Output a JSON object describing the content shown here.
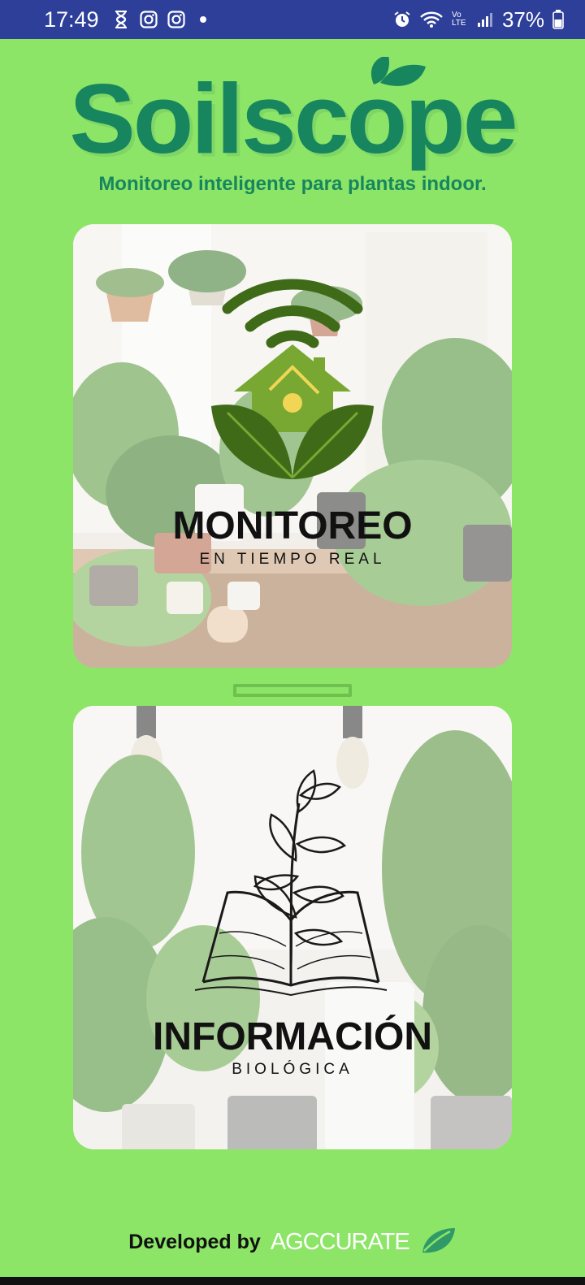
{
  "status_bar": {
    "time": "17:49",
    "battery": "37%",
    "network": "Vo LTE",
    "left_icons": [
      "hourglass-icon",
      "instagram-icon",
      "instagram-icon",
      "notification-dot"
    ],
    "right_icons": [
      "alarm-icon",
      "wifi-icon",
      "signal-icon",
      "battery-icon"
    ]
  },
  "header": {
    "app_name": "Soilscope",
    "tagline": "Monitoreo inteligente para plantas indoor.",
    "brand_color": "#17865e"
  },
  "cards": [
    {
      "title": "MONITOREO",
      "subtitle": "EN TIEMPO REAL",
      "icon": "smart-home-plant-icon"
    },
    {
      "title": "INFORMACIÓN",
      "subtitle": "BIOLÓGICA",
      "icon": "book-plant-icon"
    }
  ],
  "footer": {
    "developed_by": "Developed by",
    "brand": "AGCCURATE",
    "brand_icon": "leaf-icon"
  },
  "colors": {
    "background": "#8ce567",
    "status_bar": "#2e3f9a"
  }
}
